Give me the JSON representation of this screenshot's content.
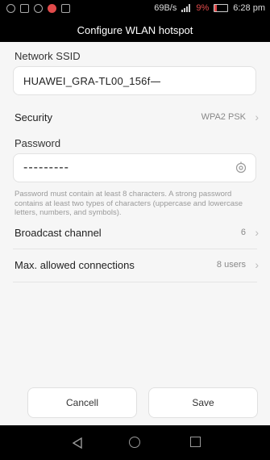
{
  "status_bar": {
    "speed": "69B/s",
    "battery_percent": "9%",
    "time": "6:28 pm"
  },
  "title": "Configure WLAN hotspot",
  "ssid": {
    "label": "Network SSID",
    "value": "HUAWEI_GRA-TL00_156f"
  },
  "security": {
    "label": "Security",
    "value": "WPA2 PSK"
  },
  "password": {
    "label": "Password",
    "value": "---------",
    "hint": "Password must contain at least 8 characters. A strong password contains at least two types of characters (uppercase and lowercase letters, numbers, and symbols)."
  },
  "broadcast_channel": {
    "label": "Broadcast channel",
    "value": "6"
  },
  "max_connections": {
    "label": "Max. allowed connections",
    "value": "8 users"
  },
  "buttons": {
    "cancel": "Cancell",
    "save": "Save"
  },
  "icons": {
    "eye": "eye-icon",
    "chevron": "chevron-right-icon",
    "back": "nav-back-icon",
    "home": "nav-home-icon",
    "recent": "nav-recent-icon"
  }
}
